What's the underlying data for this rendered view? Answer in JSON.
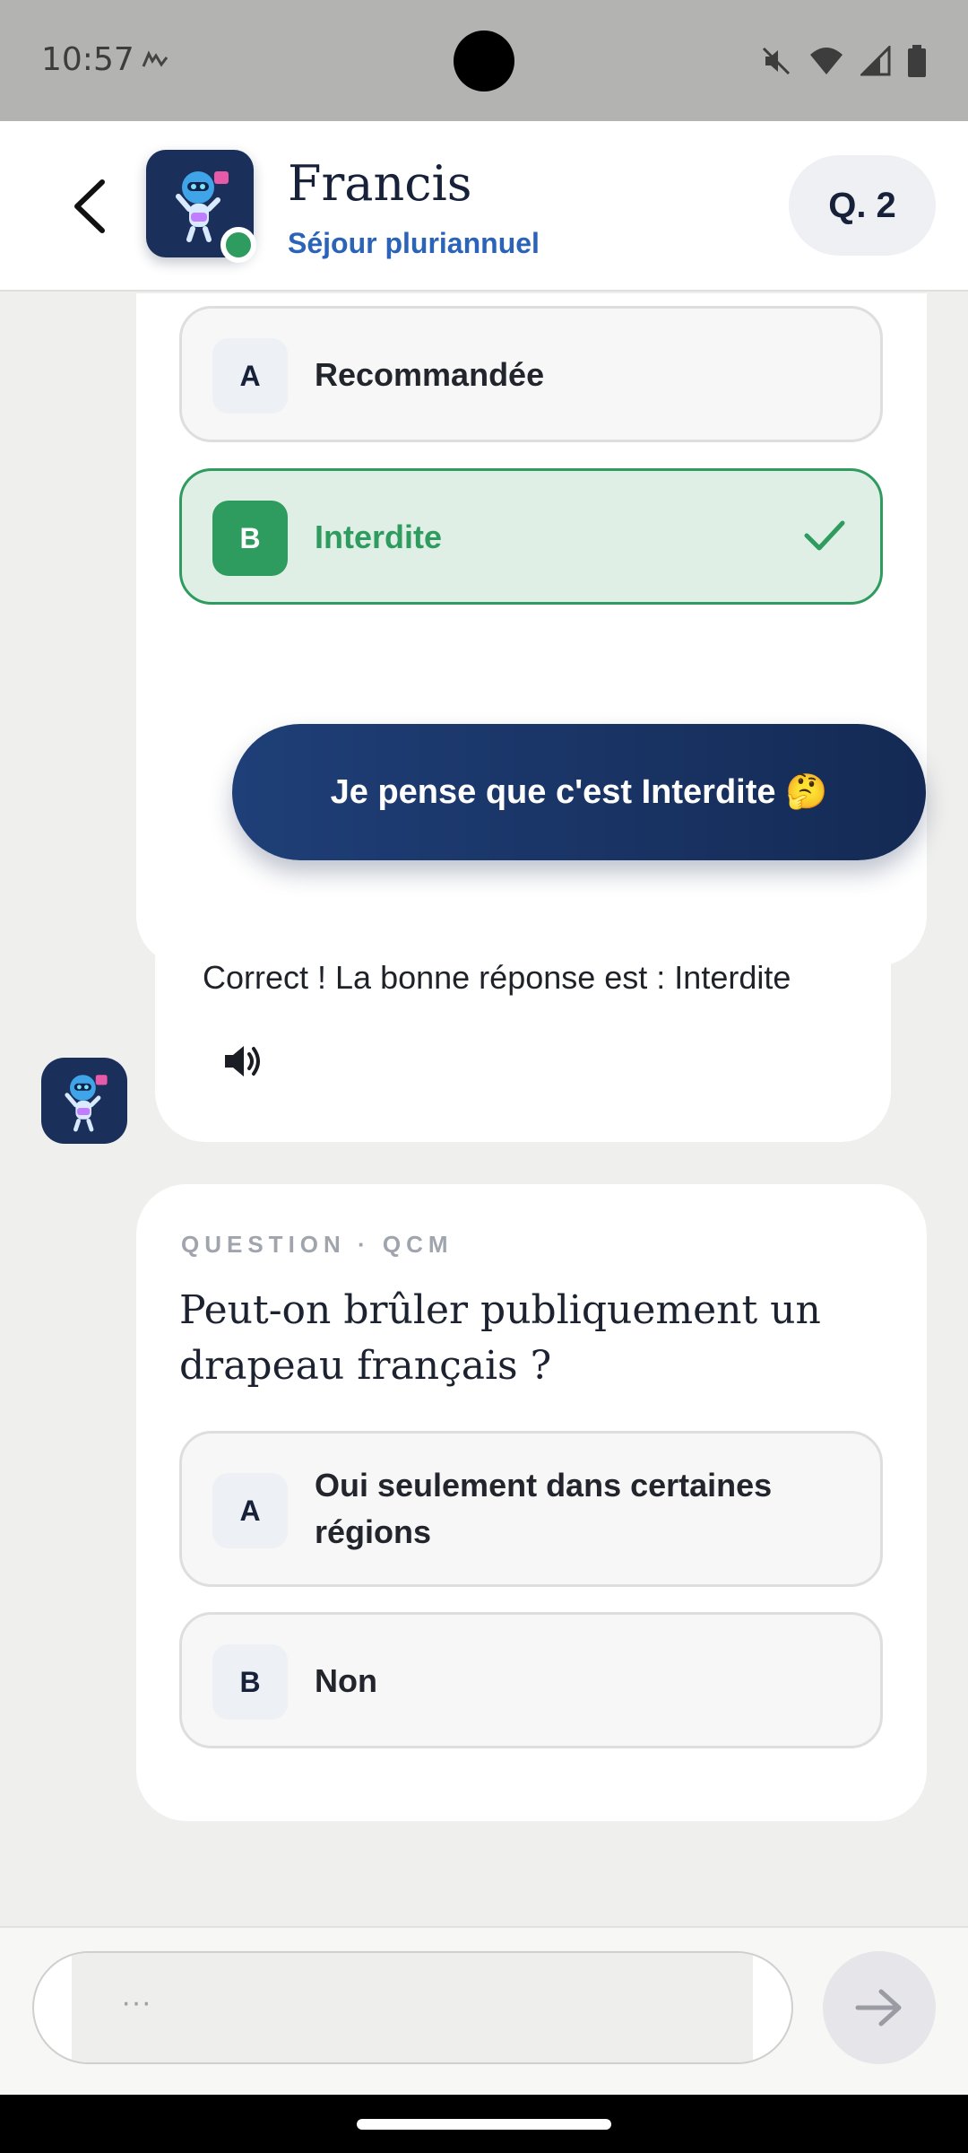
{
  "status_bar": {
    "time": "10:57"
  },
  "header": {
    "name": "Francis",
    "subtitle": "Séjour pluriannuel",
    "question_badge": "Q. 2",
    "online": true
  },
  "previous_question": {
    "options": [
      {
        "letter": "A",
        "label": "Recommandée",
        "state": "default"
      },
      {
        "letter": "B",
        "label": "Interdite",
        "state": "correct"
      }
    ]
  },
  "user_message": "Je pense que c'est Interdite 🤔",
  "bot_message": "Correct ! La bonne réponse est : Interdite",
  "current_question": {
    "label": "QUESTION · QCM",
    "text": "Peut-on brûler publiquement un drapeau français ?",
    "options": [
      {
        "letter": "A",
        "label": "Oui seulement dans certaines régions"
      },
      {
        "letter": "B",
        "label": "Non"
      }
    ]
  },
  "input": {
    "placeholder": "···"
  },
  "colors": {
    "navy": "#1a2f5a",
    "accent_blue": "#2a63b8",
    "correct_green": "#2e9b5f",
    "background": "#efefed"
  },
  "icons": [
    "back-arrow-icon",
    "robot-avatar-icon",
    "check-icon",
    "speaker-icon",
    "arrow-right-icon",
    "mute-icon",
    "wifi-icon",
    "signal-icon",
    "battery-icon"
  ]
}
